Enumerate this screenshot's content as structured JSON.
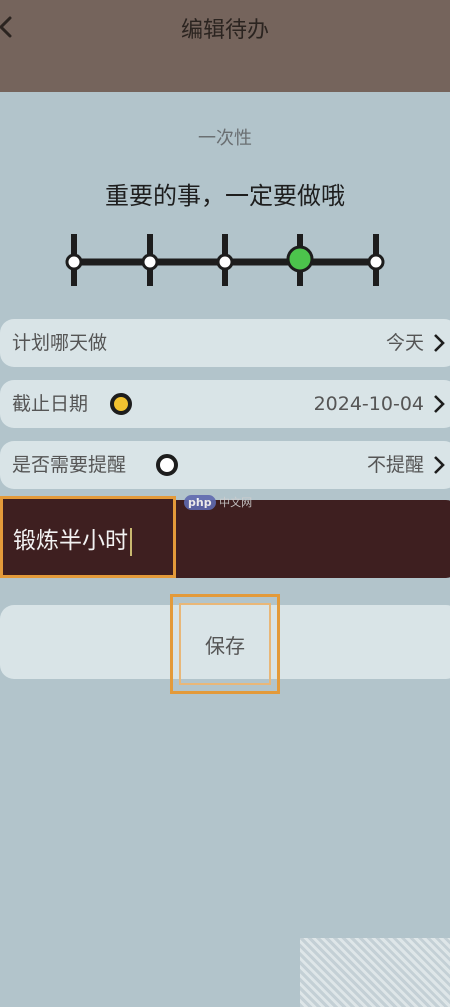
{
  "header": {
    "title": "编辑待办",
    "back_icon": "chevron-left-icon"
  },
  "priority": {
    "type": "一次性",
    "description": "重要的事，一定要做哦",
    "level_count": 5,
    "selected_level": 4,
    "selected_color": "#4cc44c"
  },
  "rows": {
    "plan": {
      "label": "计划哪天做",
      "value": "今天"
    },
    "deadline": {
      "label": "截止日期",
      "value": "2024-10-04",
      "indicator_color": "#f2c230"
    },
    "reminder": {
      "label": "是否需要提醒",
      "value": "不提醒"
    }
  },
  "input": {
    "value": "锻炼半小时"
  },
  "save": {
    "label": "保存"
  },
  "watermark": {
    "brand": "php",
    "text": "中文网"
  },
  "colors": {
    "header": "#75645c",
    "background": "#b2c4cb",
    "row": "#d9e4e7",
    "input": "#3e1f20",
    "highlight": "#e39a3a"
  }
}
